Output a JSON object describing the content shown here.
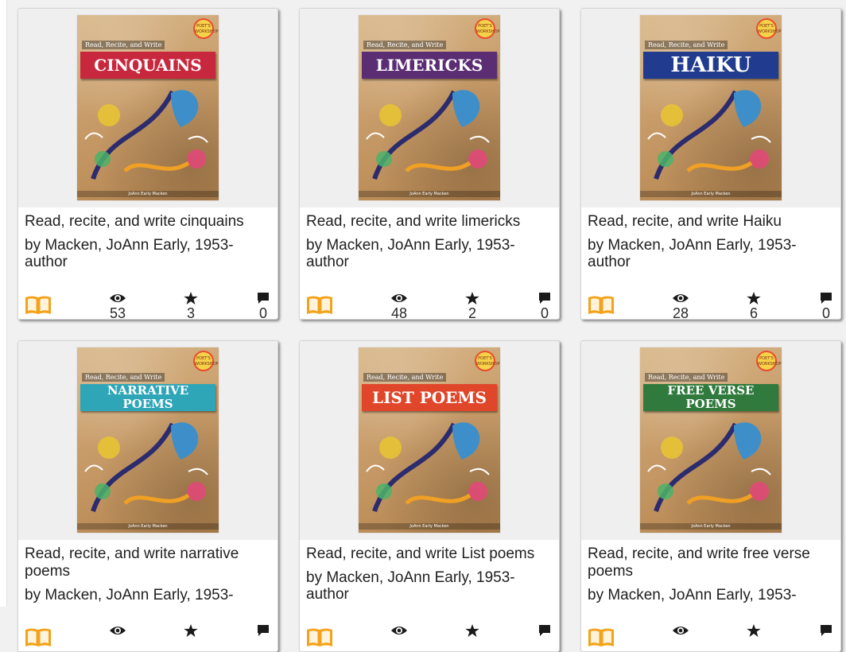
{
  "cards": [
    {
      "title": "Read, recite, and write cinquains",
      "byline": "by Macken, JoAnn Early, 1953- author",
      "views": "53",
      "rating": "3",
      "comments": "0",
      "cover": {
        "series": "Read, Recite, and Write",
        "banner": "CINQUAINS",
        "banner_color": "#c8283e",
        "badge": "POET'S WORKSHOP",
        "author": "JoAnn Early Macken"
      }
    },
    {
      "title": "Read, recite, and write limericks",
      "byline": "by Macken, JoAnn Early, 1953- author",
      "views": "48",
      "rating": "2",
      "comments": "0",
      "cover": {
        "series": "Read, Recite, and Write",
        "banner": "LIMERICKS",
        "banner_color": "#5b2e73",
        "badge": "POET'S WORKSHOP",
        "author": "JoAnn Early Macken"
      }
    },
    {
      "title": "Read, recite, and write Haiku",
      "byline": "by Macken, JoAnn Early, 1953- author",
      "views": "28",
      "rating": "6",
      "comments": "0",
      "cover": {
        "series": "Read, Recite, and Write",
        "banner": "HAIKU",
        "banner_color": "#213c8f",
        "badge": "POET'S WORKSHOP",
        "author": "JoAnn Early Macken"
      }
    },
    {
      "title": "Read, recite, and write narrative poems",
      "byline": "by Macken, JoAnn Early, 1953-",
      "views": "",
      "rating": "",
      "comments": "",
      "cover": {
        "series": "Read, Recite, and Write",
        "banner": "NARRATIVE POEMS",
        "banner_color": "#2fa6b8",
        "badge": "POET'S WORKSHOP",
        "author": "JoAnn Early Macken"
      }
    },
    {
      "title": "Read, recite, and write List poems",
      "byline": "by Macken, JoAnn Early, 1953- author",
      "views": "",
      "rating": "",
      "comments": "",
      "cover": {
        "series": "Read, Recite, and Write",
        "banner": "LIST POEMS",
        "banner_color": "#e0462a",
        "badge": "POET'S WORKSHOP",
        "author": "JoAnn Early Macken"
      }
    },
    {
      "title": "Read, recite, and write free verse poems",
      "byline": "by Macken, JoAnn Early, 1953-",
      "views": "",
      "rating": "",
      "comments": "",
      "cover": {
        "series": "Read, Recite, and Write",
        "banner": "FREE VERSE POEMS",
        "banner_color": "#2f7a3c",
        "badge": "POET'S WORKSHOP",
        "author": "JoAnn Early Macken"
      }
    }
  ],
  "colors": {
    "book_icon": "#f3a31b",
    "stat_icon": "#1a1a1a"
  },
  "icons": {
    "format": "book-icon",
    "views": "eye-icon",
    "rating": "star-icon",
    "comments": "comment-icon"
  }
}
